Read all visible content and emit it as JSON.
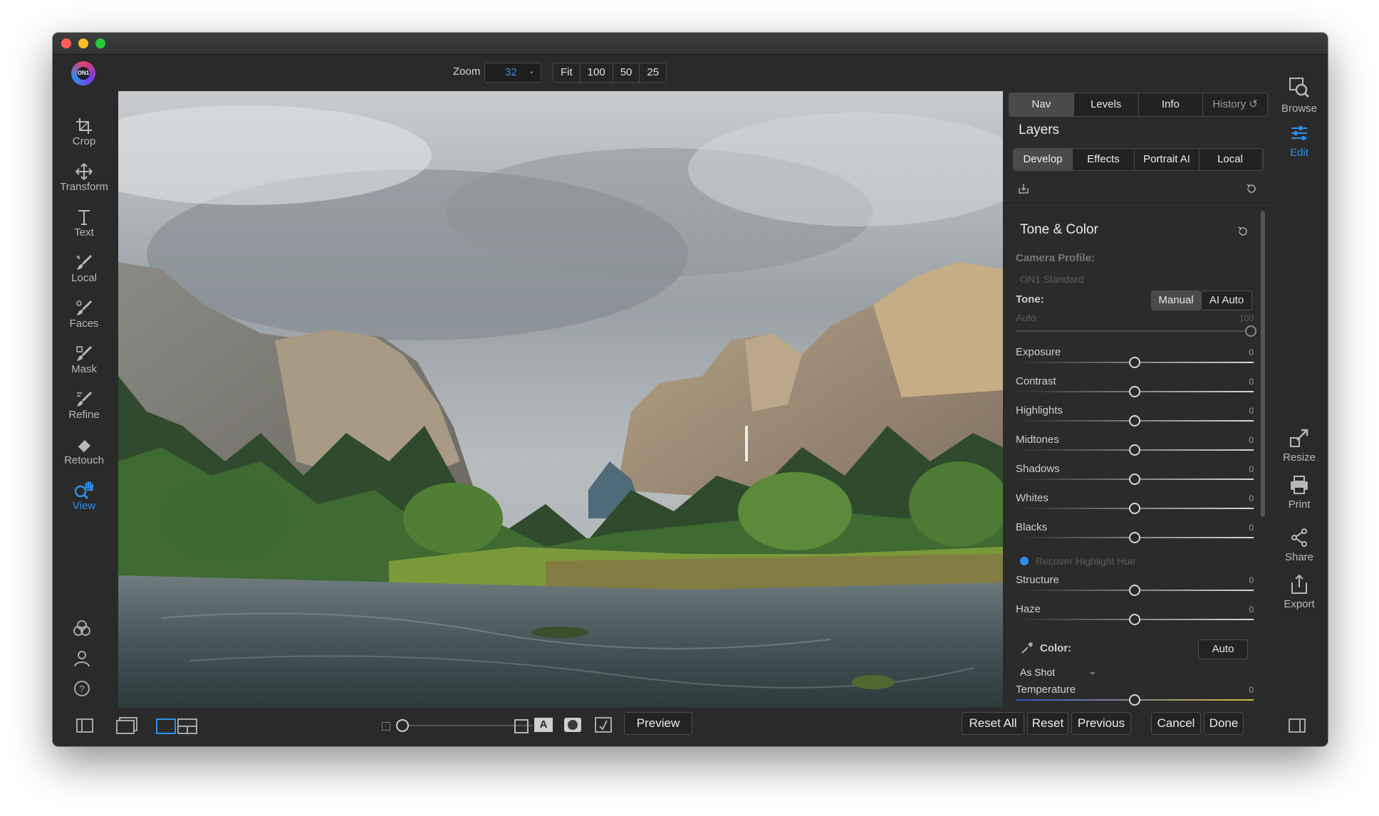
{
  "toolbar": {
    "zoom_label": "Zoom",
    "zoom_value": "32",
    "zoom_presets": [
      "Fit",
      "100",
      "50",
      "25"
    ]
  },
  "left_tools": [
    {
      "label": "Crop",
      "icon": "crop-icon"
    },
    {
      "label": "Transform",
      "icon": "move-icon"
    },
    {
      "label": "Text",
      "icon": "text-icon"
    },
    {
      "label": "Local",
      "icon": "brush-icon"
    },
    {
      "label": "Faces",
      "icon": "face-brush-icon"
    },
    {
      "label": "Mask",
      "icon": "mask-brush-icon"
    },
    {
      "label": "Refine",
      "icon": "refine-brush-icon"
    },
    {
      "label": "Retouch",
      "icon": "eraser-icon"
    },
    {
      "label": "View",
      "icon": "view-hand-icon",
      "active": true
    }
  ],
  "panel": {
    "nav_tabs": [
      "Nav",
      "Levels",
      "Info",
      "History"
    ],
    "layers_title": "Layers",
    "dev_tabs": [
      "Develop",
      "Effects",
      "Portrait AI",
      "Local"
    ],
    "section_title": "Tone & Color",
    "camera_profile_label": "Camera Profile:",
    "camera_profile_value": "ON1 Standard",
    "tone_label": "Tone:",
    "tone_modes": [
      "Manual",
      "AI Auto"
    ],
    "auto_label": "Auto",
    "auto_value": "100",
    "sliders": [
      {
        "name": "Exposure",
        "value": "0"
      },
      {
        "name": "Contrast",
        "value": "0"
      },
      {
        "name": "Highlights",
        "value": "0"
      },
      {
        "name": "Midtones",
        "value": "0"
      },
      {
        "name": "Shadows",
        "value": "0"
      },
      {
        "name": "Whites",
        "value": "0"
      },
      {
        "name": "Blacks",
        "value": "0"
      }
    ],
    "recover_label": "Recover Highlight Hue",
    "sliders2": [
      {
        "name": "Structure",
        "value": "0"
      },
      {
        "name": "Haze",
        "value": "0"
      }
    ],
    "color_label": "Color:",
    "color_auto": "Auto",
    "white_balance": "As Shot",
    "temperature_label": "Temperature",
    "temperature_value": "0"
  },
  "right_tools": [
    {
      "label": "Browse",
      "icon": "browse-icon"
    },
    {
      "label": "Edit",
      "icon": "edit-sliders-icon",
      "active": true
    },
    {
      "label": "Resize",
      "icon": "resize-icon"
    },
    {
      "label": "Print",
      "icon": "print-icon"
    },
    {
      "label": "Share",
      "icon": "share-icon"
    },
    {
      "label": "Export",
      "icon": "export-icon"
    }
  ],
  "bottom": {
    "preview": "Preview",
    "reset_all": "Reset All",
    "reset": "Reset",
    "previous": "Previous",
    "cancel": "Cancel",
    "done": "Done"
  },
  "colors": {
    "accent": "#2f8ff0",
    "background": "#2a2a2a"
  }
}
